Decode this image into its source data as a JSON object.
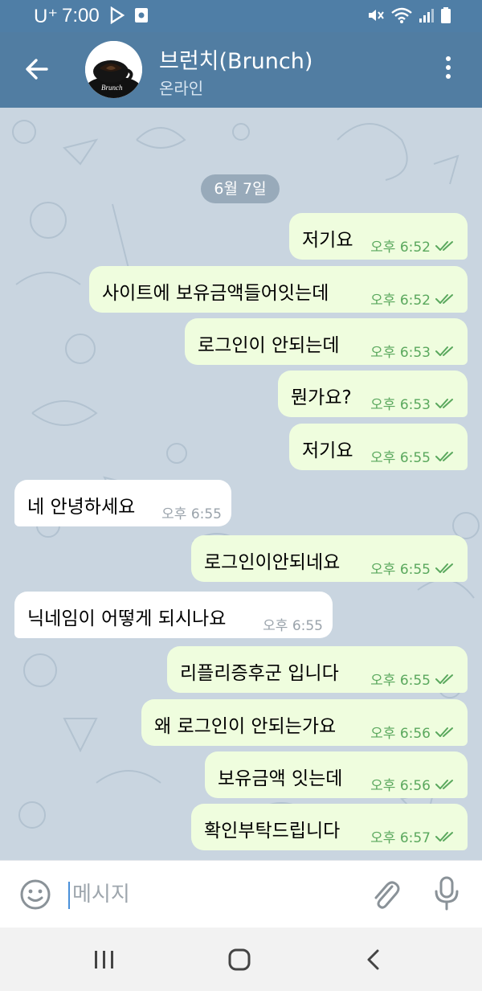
{
  "status_bar": {
    "carrier": "U⁺",
    "time": "7:00",
    "icons": [
      "play-store-icon",
      "screenshot-icon",
      "mute-icon",
      "wifi-icon",
      "signal-icon",
      "battery-icon"
    ]
  },
  "header": {
    "title": "브런치(Brunch)",
    "status": "온라인",
    "avatar_text": "Brunch",
    "colors": {
      "header_bg": "#517da2",
      "status_bg": "#4f7ea6"
    }
  },
  "chat": {
    "date": "6월 7일",
    "messages": [
      {
        "dir": "out",
        "text": "저기요",
        "time": "오후 6:52"
      },
      {
        "dir": "out",
        "text": "사이트에 보유금액들어잇는데",
        "time": "오후 6:52"
      },
      {
        "dir": "out",
        "text": "로그인이 안되는데",
        "time": "오후 6:53"
      },
      {
        "dir": "out",
        "text": "뭔가요?",
        "time": "오후 6:53"
      },
      {
        "dir": "out",
        "text": "저기요",
        "time": "오후 6:55"
      },
      {
        "dir": "in",
        "text": "네 안녕하세요",
        "time": "오후 6:55"
      },
      {
        "dir": "out",
        "text": "로그인이안되네요",
        "time": "오후 6:55"
      },
      {
        "dir": "in",
        "text": "닉네임이 어떻게 되시나요",
        "time": "오후 6:55"
      },
      {
        "dir": "out",
        "text": "리플리증후군 입니다",
        "time": "오후 6:55"
      },
      {
        "dir": "out",
        "text": "왜 로그인이 안되는가요",
        "time": "오후 6:56"
      },
      {
        "dir": "out",
        "text": "보유금액 잇는데",
        "time": "오후 6:56"
      },
      {
        "dir": "out",
        "text": "확인부탁드립니다",
        "time": "오후 6:57"
      }
    ],
    "colors": {
      "outgoing_bubble": "#effdde",
      "incoming_bubble": "#ffffff",
      "read_check": "#5aa85d"
    }
  },
  "input": {
    "placeholder": "메시지",
    "value": ""
  },
  "nav": {
    "buttons": [
      "recent-apps-icon",
      "home-icon",
      "back-nav-icon"
    ]
  }
}
